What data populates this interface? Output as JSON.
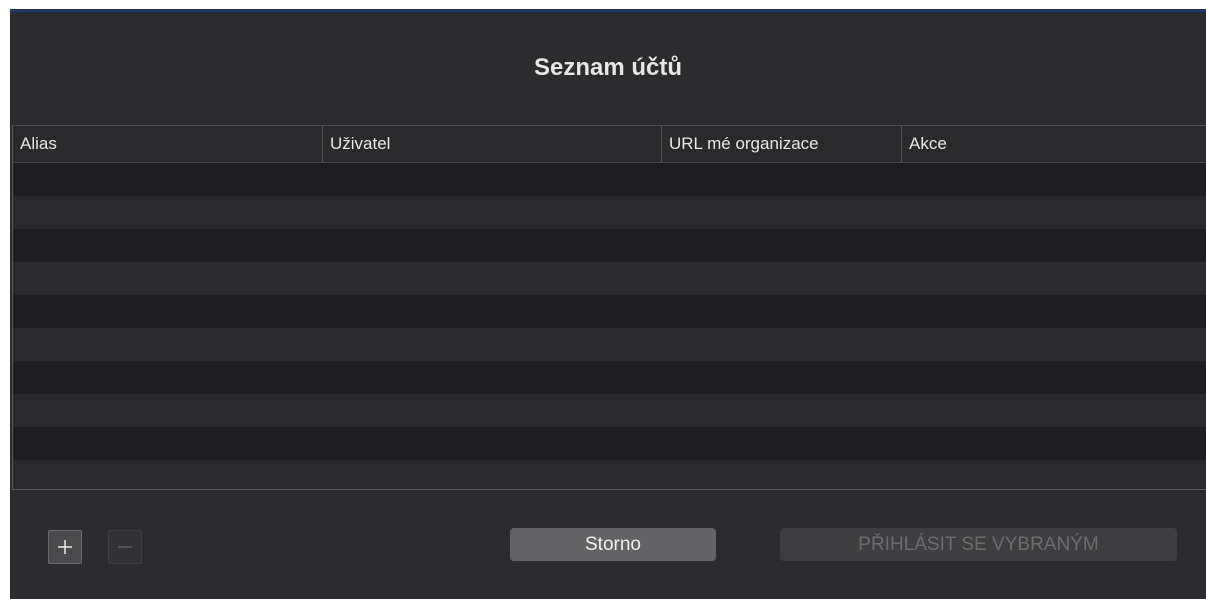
{
  "dialog": {
    "title": "Seznam účtů"
  },
  "table": {
    "columns": [
      {
        "label": "Alias"
      },
      {
        "label": "Uživatel"
      },
      {
        "label": "URL mé organizace"
      },
      {
        "label": "Akce"
      }
    ],
    "rows": []
  },
  "footer": {
    "add_icon": "plus-icon",
    "remove_icon": "minus-icon",
    "cancel_label": "Storno",
    "login_label": "PŘIHLÁSIT SE VYBRANÝM"
  },
  "colors": {
    "sheet_background": "#2c2c2e",
    "accent_bar": "#1f3a66"
  }
}
